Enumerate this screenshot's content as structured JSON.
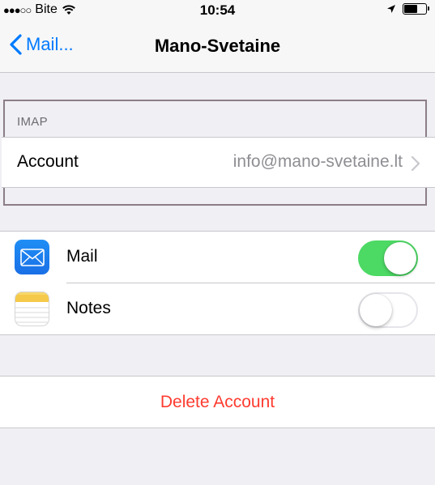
{
  "status_bar": {
    "signal": "●●●○○",
    "carrier": "Bite",
    "time": "10:54",
    "battery_level_percent": 60
  },
  "nav": {
    "back_label": "Mail...",
    "title": "Mano-Svetaine"
  },
  "imap_section": {
    "header": "IMAP",
    "account_label": "Account",
    "account_value": "info@mano-svetaine.lt"
  },
  "apps": [
    {
      "label": "Mail",
      "icon": "mail-icon",
      "enabled": true
    },
    {
      "label": "Notes",
      "icon": "notes-icon",
      "enabled": false
    }
  ],
  "delete_label": "Delete Account",
  "colors": {
    "accent": "#007aff",
    "toggle_on": "#4cd964",
    "destructive": "#ff3b30",
    "background": "#efeff4"
  }
}
